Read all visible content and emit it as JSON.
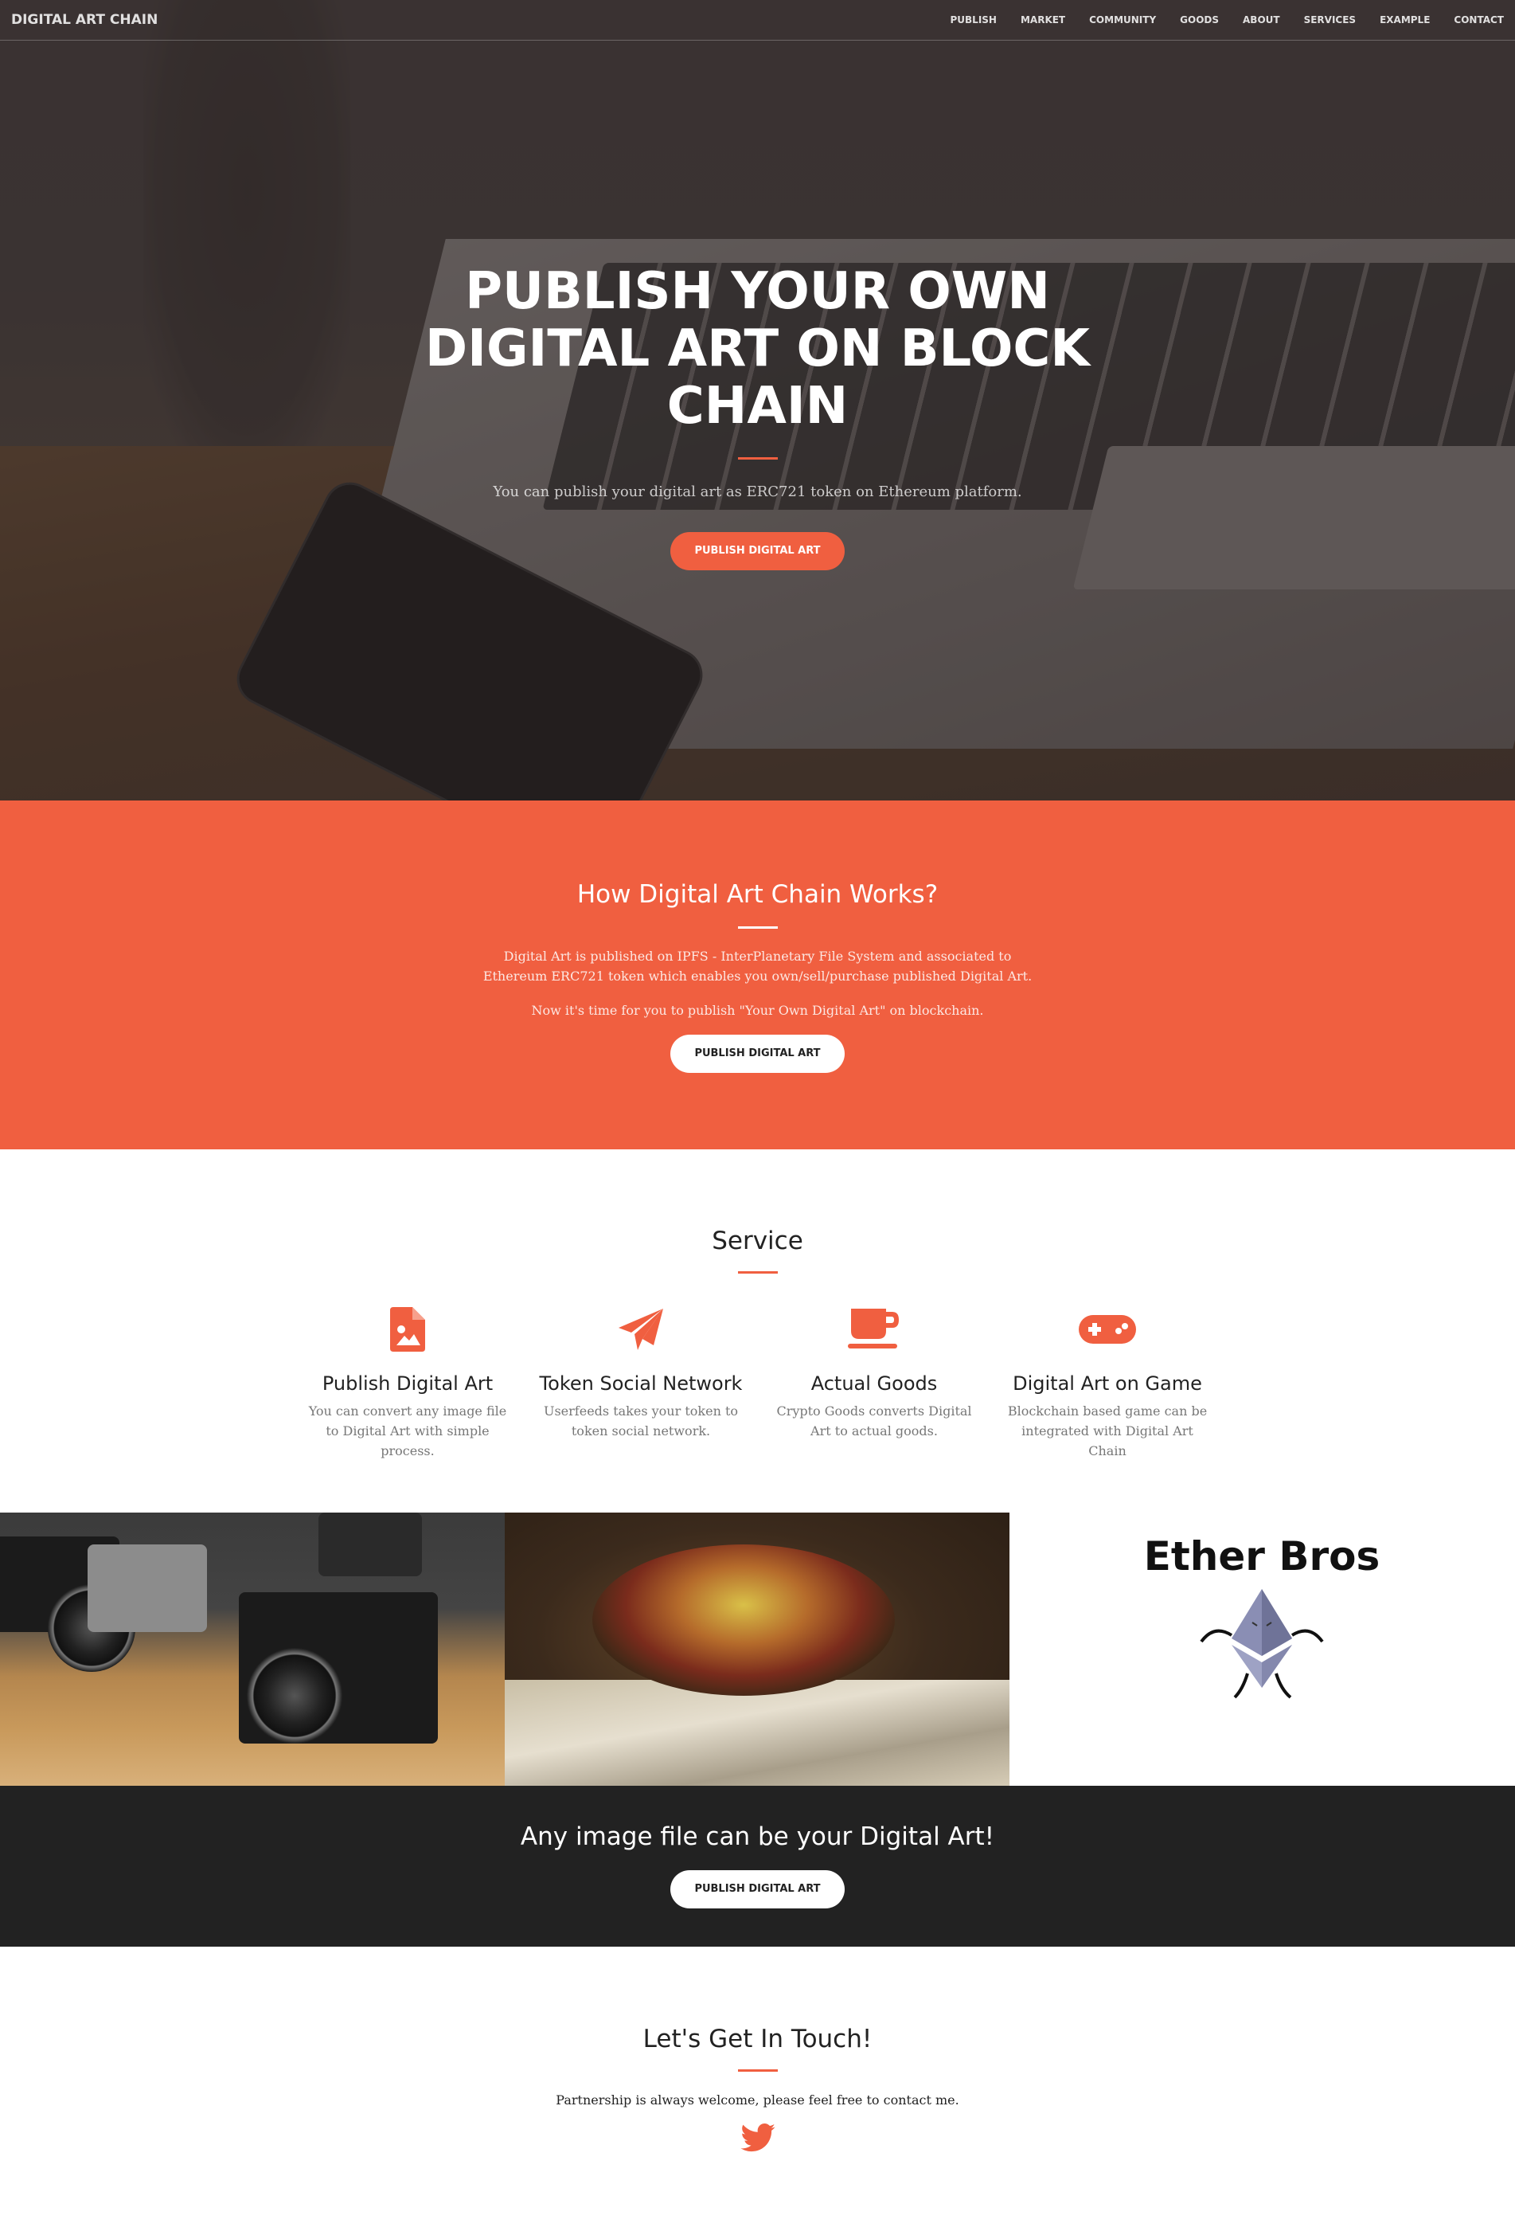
{
  "nav": {
    "brand": "DIGITAL ART CHAIN",
    "links": [
      "PUBLISH",
      "MARKET",
      "COMMUNITY",
      "GOODS",
      "ABOUT",
      "SERVICES",
      "EXAMPLE",
      "CONTACT"
    ]
  },
  "hero": {
    "title": "PUBLISH YOUR OWN DIGITAL ART ON BLOCK CHAIN",
    "subtitle": "You can publish your digital art as ERC721 token on Ethereum platform.",
    "button": "PUBLISH DIGITAL ART"
  },
  "about": {
    "heading": "How Digital Art Chain Works?",
    "paragraph1": "Digital Art is published on IPFS - InterPlanetary File System and associated to Ethereum ERC721 token which enables you own/sell/purchase published Digital Art.",
    "paragraph2": "Now it's time for you to publish \"Your Own Digital Art\" on blockchain.",
    "button": "PUBLISH DIGITAL ART"
  },
  "service": {
    "heading": "Service",
    "items": [
      {
        "icon": "image-file-icon",
        "title": "Publish Digital Art",
        "text": "You can convert any image file to Digital Art with simple process."
      },
      {
        "icon": "paper-plane-icon",
        "title": "Token Social Network",
        "text": "Userfeeds takes your token to token social network."
      },
      {
        "icon": "coffee-cup-icon",
        "title": "Actual Goods",
        "text": "Crypto Goods converts Digital Art to actual goods."
      },
      {
        "icon": "gamepad-icon",
        "title": "Digital Art on Game",
        "text": "Blockchain based game can be integrated with Digital Art Chain"
      }
    ]
  },
  "gallery": {
    "ether_title": "Ether Bros"
  },
  "cta": {
    "heading": "Any image file can be your Digital Art!",
    "button": "PUBLISH DIGITAL ART"
  },
  "contact": {
    "heading": "Let's Get In Touch!",
    "text": "Partnership is always welcome, please feel free to contact me.",
    "icon": "twitter-icon"
  },
  "colors": {
    "accent": "#f05f40",
    "dark": "#222222"
  }
}
